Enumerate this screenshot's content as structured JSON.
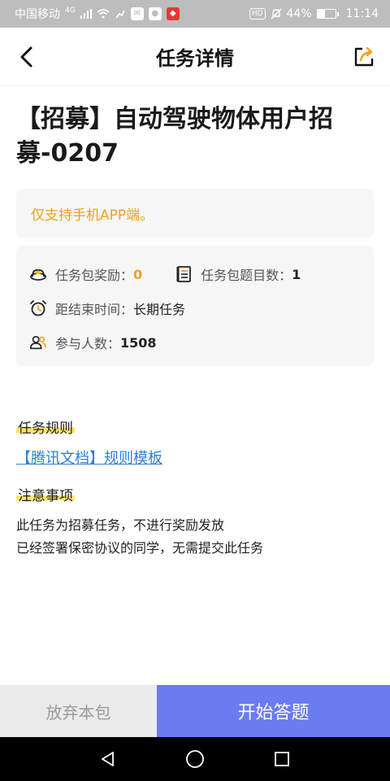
{
  "status_bar": {
    "carrier": "中国移动",
    "network": "4G",
    "battery": "44%",
    "battery_level": 0.44,
    "time": "11:14",
    "hd": "HD"
  },
  "header": {
    "title": "任务详情",
    "back_icon": "chevron-left-icon",
    "share_icon": "share-export-icon"
  },
  "task": {
    "title": "【招募】自动驾驶物体用户招募-0207",
    "notice": "仅支持手机APP端。",
    "reward_label": "任务包奖励：",
    "reward_value": "0",
    "question_count_label": "任务包题目数：",
    "question_count_value": "1",
    "end_time_label": "距结束时间：",
    "end_time_value": "长期任务",
    "participants_label": "参与人数：",
    "participants_value": "1508"
  },
  "rules": {
    "heading": "任务规则",
    "link_text": "【腾讯文档】规则模板"
  },
  "notes": {
    "heading": "注意事项",
    "line1": "此任务为招募任务，不进行奖励发放",
    "line2": "已经签署保密协议的同学，无需提交此任务"
  },
  "actions": {
    "abandon_label": "放弃本包",
    "start_label": "开始答题"
  },
  "colors": {
    "accent": "#6b7bf0",
    "warning": "#f0a020",
    "link": "#2f80d8",
    "highlight": "#ffe46a"
  }
}
